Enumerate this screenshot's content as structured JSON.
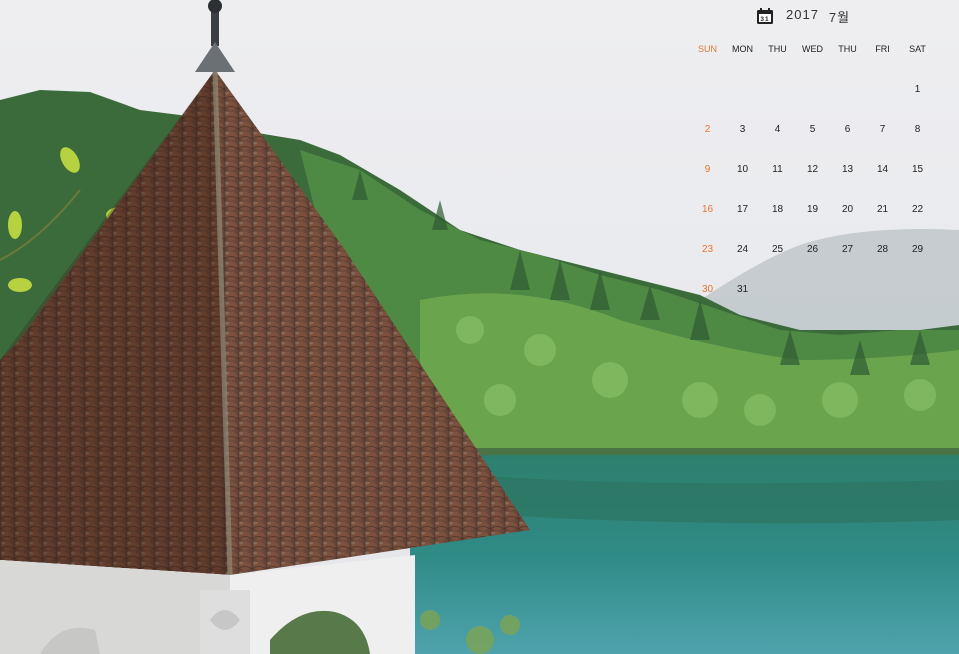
{
  "calendar": {
    "icon_day": "31",
    "year": "2017",
    "month": "7월",
    "weekdays": [
      "SUN",
      "MON",
      "THU",
      "WED",
      "THU",
      "FRI",
      "SAT"
    ],
    "weeks": [
      [
        "",
        "",
        "",
        "",
        "",
        "",
        "1"
      ],
      [
        "2",
        "3",
        "4",
        "5",
        "6",
        "7",
        "8"
      ],
      [
        "9",
        "10",
        "11",
        "12",
        "13",
        "14",
        "15"
      ],
      [
        "16",
        "17",
        "18",
        "19",
        "20",
        "21",
        "22"
      ],
      [
        "23",
        "24",
        "25",
        "26",
        "27",
        "28",
        "29"
      ],
      [
        "30",
        "31",
        "",
        "",
        "",
        "",
        ""
      ]
    ]
  },
  "colors": {
    "sunday": "#e5762f",
    "text": "#222222",
    "sky": "#e9eaee",
    "lake": "#2f8a84",
    "roof": "#6b4030"
  },
  "icons": [
    "calendar-icon"
  ]
}
